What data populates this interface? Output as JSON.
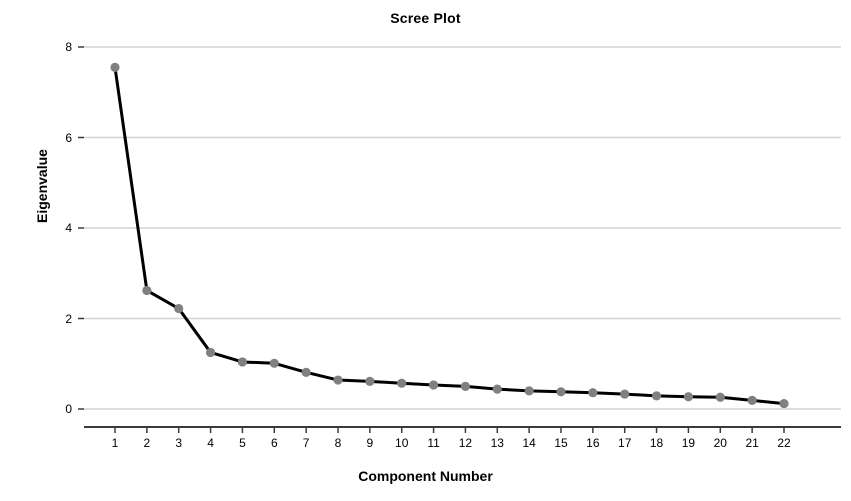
{
  "chart_data": {
    "type": "line",
    "title": "Scree Plot",
    "xlabel": "Component Number",
    "ylabel": "Eigenvalue",
    "categories": [
      "1",
      "2",
      "3",
      "4",
      "5",
      "6",
      "7",
      "8",
      "9",
      "10",
      "11",
      "12",
      "13",
      "14",
      "15",
      "16",
      "17",
      "18",
      "19",
      "20",
      "21",
      "22"
    ],
    "x": [
      1,
      2,
      3,
      4,
      5,
      6,
      7,
      8,
      9,
      10,
      11,
      12,
      13,
      14,
      15,
      16,
      17,
      18,
      19,
      20,
      21,
      22
    ],
    "values": [
      7.55,
      2.62,
      2.22,
      1.25,
      1.04,
      1.01,
      0.81,
      0.64,
      0.61,
      0.57,
      0.53,
      0.5,
      0.44,
      0.4,
      0.38,
      0.36,
      0.33,
      0.29,
      0.27,
      0.26,
      0.19,
      0.12
    ],
    "xlim": [
      0.4,
      22.7
    ],
    "ylim": [
      -0.4,
      8.8
    ],
    "yticks": [
      0,
      2,
      4,
      6,
      8
    ],
    "ytick_labels": [
      "0",
      "2",
      "4",
      "6",
      "8"
    ],
    "xticks": [
      1,
      2,
      3,
      4,
      5,
      6,
      7,
      8,
      9,
      10,
      11,
      12,
      13,
      14,
      15,
      16,
      17,
      18,
      19,
      20,
      21,
      22
    ],
    "grid": "horizontal",
    "legend": "none",
    "series": [
      {
        "name": "Eigenvalue",
        "values": [
          7.55,
          2.62,
          2.22,
          1.25,
          1.04,
          1.01,
          0.81,
          0.64,
          0.61,
          0.57,
          0.53,
          0.5,
          0.44,
          0.4,
          0.38,
          0.36,
          0.33,
          0.29,
          0.27,
          0.26,
          0.19,
          0.12
        ],
        "line_color": "#000000",
        "marker_color": "#808080",
        "marker": "circle"
      }
    ],
    "colors": {
      "background": "#ffffff",
      "grid": "#d3d3d3",
      "axis": "#3a3a3a",
      "line": "#000000",
      "marker": "#808080",
      "text": "#000000"
    }
  }
}
